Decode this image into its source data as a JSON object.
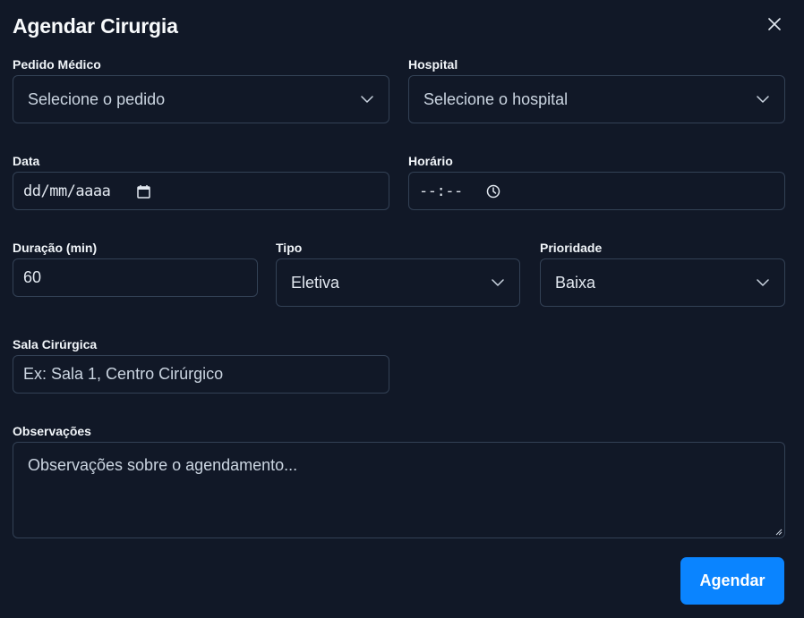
{
  "dialog": {
    "title": "Agendar Cirurgia",
    "close_icon": "close-icon"
  },
  "form": {
    "pedido": {
      "label": "Pedido Médico",
      "value": "Selecione o pedido"
    },
    "hospital": {
      "label": "Hospital",
      "value": "Selecione o hospital"
    },
    "data": {
      "label": "Data",
      "value": "dd/mm/aaaa",
      "icon": "calendar-icon"
    },
    "horario": {
      "label": "Horário",
      "value": "--:--",
      "icon": "clock-icon"
    },
    "duracao": {
      "label": "Duração (min)",
      "value": "60"
    },
    "tipo": {
      "label": "Tipo",
      "value": "Eletiva"
    },
    "prioridade": {
      "label": "Prioridade",
      "value": "Baixa"
    },
    "sala": {
      "label": "Sala Cirúrgica",
      "placeholder": "Ex: Sala 1, Centro Cirúrgico"
    },
    "observacoes": {
      "label": "Observações",
      "placeholder": "Observações sobre o agendamento..."
    }
  },
  "actions": {
    "submit_label": "Agendar"
  },
  "colors": {
    "background": "#111827",
    "border": "#334155",
    "accent": "#0a84ff",
    "text": "#e2e8f0"
  }
}
